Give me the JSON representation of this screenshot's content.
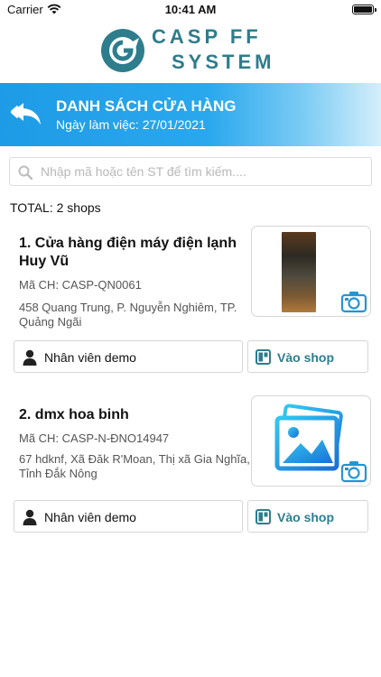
{
  "status_bar": {
    "carrier": "Carrier",
    "time": "10:41 AM"
  },
  "brand": {
    "line1": "CASP FF",
    "line2": "SYSTEM",
    "color": "#2e7d8c"
  },
  "header": {
    "title": "DANH SÁCH CỬA HÀNG",
    "work_date": "Ngày làm việc: 27/01/2021",
    "accent": "#1e9be6"
  },
  "search": {
    "placeholder": "Nhập mã hoặc tên ST để tìm kiếm....",
    "value": ""
  },
  "total_label": "TOTAL: 2 shops",
  "shops": [
    {
      "title": "1.  Cửa hàng điện máy điện lạnh Huy Vũ",
      "code": "Mã CH: CASP-QN0061",
      "address": "458 Quang Trung, P. Nguyễn Nghiêm, TP. Quảng Ngãi",
      "staff": "Nhân viên demo",
      "enter": "Vào shop",
      "photo": "shop-photo"
    },
    {
      "title": "2.  dmx hoa binh",
      "code": "Mã CH: CASP-N-ĐNO14947",
      "address": "67 hdknf, Xã Đăk R'Moan, Thị xã Gia Nghĩa, Tỉnh Đắk Nông",
      "staff": "Nhân viên demo",
      "enter": "Vào shop",
      "photo": "image-placeholder-icon"
    }
  ]
}
